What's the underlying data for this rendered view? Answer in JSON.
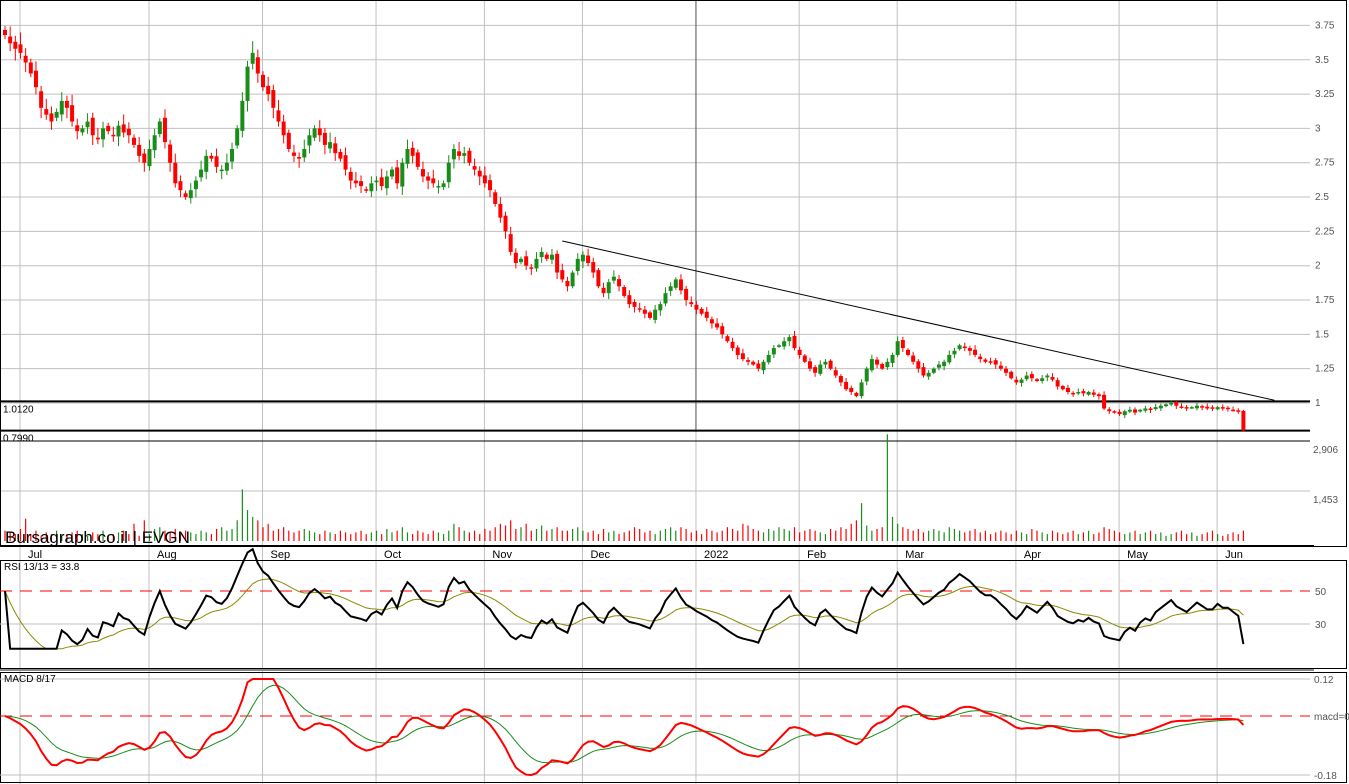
{
  "chart_data": {
    "type": "candlestick",
    "brand": "Bursagraph.co.il | EVGN",
    "symbol": "EVGN",
    "months": [
      "Jul",
      "Aug",
      "Sep",
      "Oct",
      "Nov",
      "Dec",
      "2022",
      "Feb",
      "Mar",
      "Apr",
      "May",
      "Jun"
    ],
    "month_start_index": [
      0,
      25,
      47,
      69,
      90,
      109,
      131,
      151,
      170,
      193,
      213,
      232
    ],
    "price_axis": {
      "ticks": [
        "3.75",
        "3.5",
        "3.25",
        "3",
        "2.75",
        "2.5",
        "2.25",
        "2",
        "1.75",
        "1.5",
        "1.25",
        "1"
      ],
      "tick_values": [
        3.75,
        3.5,
        3.25,
        3,
        2.75,
        2.5,
        2.25,
        2,
        1.75,
        1.5,
        1.25,
        1
      ],
      "range": [
        0.799,
        3.9
      ]
    },
    "levels": [
      {
        "label": "1.0120",
        "value": 1.012
      },
      {
        "label": "0.7990",
        "value": 0.799
      }
    ],
    "trendline": {
      "from": {
        "index": 108,
        "price": 2.18
      },
      "to": {
        "index": 246,
        "price": 1.02
      }
    },
    "closes": [
      3.68,
      3.62,
      3.58,
      3.55,
      3.48,
      3.4,
      3.3,
      3.15,
      3.1,
      3.05,
      3.12,
      3.2,
      3.15,
      3.05,
      2.98,
      3.0,
      3.05,
      2.95,
      2.92,
      3.0,
      2.98,
      2.95,
      3.02,
      2.97,
      2.95,
      2.88,
      2.8,
      2.75,
      2.85,
      2.95,
      3.05,
      2.9,
      2.75,
      2.6,
      2.55,
      2.5,
      2.55,
      2.62,
      2.7,
      2.8,
      2.78,
      2.72,
      2.7,
      2.75,
      2.85,
      3.0,
      3.2,
      3.45,
      3.55,
      3.4,
      3.3,
      3.25,
      3.15,
      3.05,
      2.95,
      2.85,
      2.8,
      2.78,
      2.85,
      2.95,
      3.0,
      2.95,
      2.88,
      2.9,
      2.82,
      2.78,
      2.7,
      2.62,
      2.6,
      2.58,
      2.55,
      2.6,
      2.62,
      2.58,
      2.65,
      2.7,
      2.6,
      2.75,
      2.85,
      2.8,
      2.72,
      2.65,
      2.62,
      2.6,
      2.58,
      2.6,
      2.75,
      2.85,
      2.8,
      2.82,
      2.75,
      2.7,
      2.65,
      2.6,
      2.55,
      2.45,
      2.35,
      2.25,
      2.1,
      2.02,
      2.05,
      2.0,
      1.98,
      2.05,
      2.1,
      2.05,
      2.08,
      1.95,
      1.9,
      1.85,
      1.95,
      2.05,
      2.08,
      2.02,
      1.95,
      1.85,
      1.8,
      1.88,
      1.92,
      1.85,
      1.78,
      1.72,
      1.7,
      1.68,
      1.65,
      1.62,
      1.68,
      1.72,
      1.8,
      1.85,
      1.9,
      1.82,
      1.75,
      1.72,
      1.68,
      1.65,
      1.62,
      1.58,
      1.55,
      1.5,
      1.45,
      1.4,
      1.35,
      1.32,
      1.3,
      1.28,
      1.25,
      1.3,
      1.35,
      1.4,
      1.42,
      1.45,
      1.48,
      1.4,
      1.35,
      1.3,
      1.25,
      1.22,
      1.28,
      1.3,
      1.25,
      1.2,
      1.15,
      1.1,
      1.08,
      1.05,
      1.15,
      1.25,
      1.32,
      1.28,
      1.25,
      1.3,
      1.35,
      1.45,
      1.4,
      1.35,
      1.3,
      1.25,
      1.2,
      1.22,
      1.25,
      1.28,
      1.3,
      1.35,
      1.38,
      1.42,
      1.4,
      1.38,
      1.35,
      1.32,
      1.3,
      1.3,
      1.28,
      1.25,
      1.22,
      1.18,
      1.15,
      1.17,
      1.2,
      1.18,
      1.16,
      1.18,
      1.2,
      1.17,
      1.12,
      1.1,
      1.08,
      1.07,
      1.08,
      1.07,
      1.08,
      1.06,
      1.05,
      0.96,
      0.94,
      0.93,
      0.92,
      0.94,
      0.95,
      0.93,
      0.95,
      0.96,
      0.95,
      0.97,
      0.98,
      0.99,
      1.0,
      0.98,
      0.97,
      0.96,
      0.97,
      0.98,
      0.97,
      0.96,
      0.96,
      0.97,
      0.96,
      0.96,
      0.95,
      0.94,
      0.8
    ],
    "volume_axis": {
      "ticks": [
        "2,906",
        "1,453"
      ],
      "tick_values": [
        2906,
        1453
      ]
    },
    "volumes": [
      300,
      250,
      200,
      350,
      650,
      200,
      300,
      150,
      250,
      200,
      300,
      150,
      200,
      250,
      300,
      200,
      150,
      250,
      200,
      300,
      150,
      200,
      250,
      300,
      200,
      500,
      150,
      600,
      200,
      350,
      400,
      300,
      250,
      350,
      200,
      300,
      250,
      200,
      300,
      250,
      200,
      350,
      400,
      300,
      350,
      600,
      1500,
      900,
      700,
      600,
      400,
      500,
      300,
      350,
      400,
      300,
      250,
      300,
      350,
      300,
      250,
      200,
      300,
      250,
      200,
      300,
      250,
      200,
      250,
      300,
      200,
      250,
      300,
      200,
      350,
      250,
      300,
      400,
      250,
      200,
      300,
      250,
      200,
      300,
      250,
      200,
      300,
      500,
      400,
      300,
      250,
      300,
      200,
      350,
      300,
      400,
      500,
      450,
      600,
      350,
      400,
      500,
      300,
      350,
      450,
      300,
      350,
      400,
      300,
      300,
      350,
      400,
      300,
      250,
      300,
      200,
      350,
      250,
      300,
      200,
      250,
      300,
      400,
      350,
      250,
      300,
      200,
      300,
      350,
      400,
      300,
      400,
      350,
      250,
      300,
      200,
      350,
      300,
      250,
      300,
      400,
      350,
      300,
      500,
      450,
      350,
      300,
      250,
      350,
      300,
      400,
      350,
      300,
      400,
      250,
      300,
      350,
      300,
      250,
      200,
      350,
      300,
      400,
      350,
      500,
      600,
      1100,
      450,
      300,
      350,
      400,
      3100,
      700,
      500,
      400,
      350,
      300,
      350,
      250,
      300,
      350,
      300,
      250,
      400,
      350,
      300,
      250,
      300,
      350,
      250,
      300,
      200,
      250,
      300,
      250,
      200,
      300,
      250,
      200,
      350,
      300,
      250,
      200,
      300,
      250,
      200,
      250,
      300,
      200,
      250,
      300,
      200,
      250,
      400,
      350,
      300,
      250,
      200,
      250,
      300,
      200,
      250,
      300,
      200,
      250,
      150,
      200,
      250,
      300,
      200,
      250,
      150,
      200,
      250,
      300,
      200,
      150,
      200,
      250,
      200,
      300
    ],
    "rsi": {
      "label": "RSI 13/13 = 33.8",
      "period": 13,
      "signal": 13,
      "ticks": [
        "50",
        "30"
      ],
      "tick_values": [
        50,
        30
      ],
      "reference": 50
    },
    "macd": {
      "label": "MACD 8/17",
      "fast": 8,
      "slow": 17,
      "signal": 9,
      "ticks": [
        "0.12",
        "macd=0",
        "-0.18"
      ],
      "tick_values": [
        0.12,
        0,
        -0.18
      ]
    },
    "colors": {
      "up": "#1a8c1a",
      "down": "#ff0000",
      "rsi": "#000000",
      "rsi_signal": "#8a8a00",
      "macd": "#ff0000",
      "macd_signal": "#1a8c1a",
      "grid": "#c0c0c0"
    }
  }
}
